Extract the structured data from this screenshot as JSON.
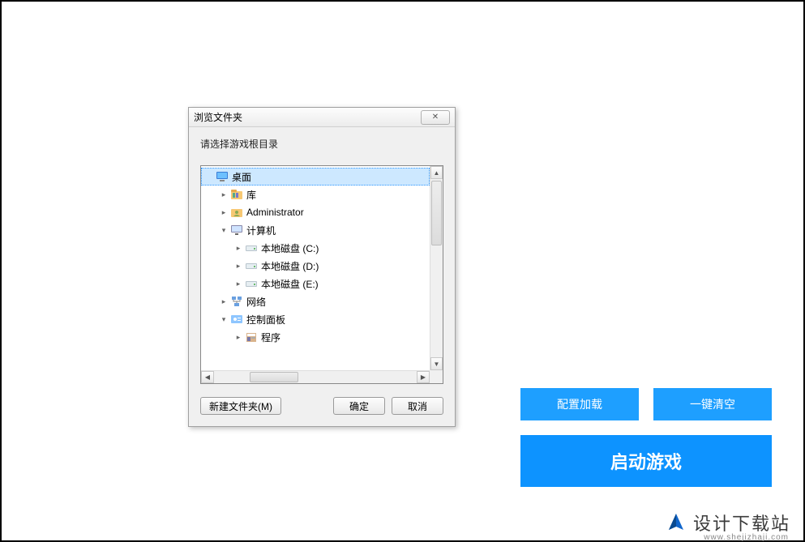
{
  "dialog": {
    "title": "浏览文件夹",
    "close_symbol": "✕",
    "prompt": "请选择游戏根目录",
    "tree": [
      {
        "indent": 0,
        "expander": "none",
        "icon": "desktop-icon",
        "label": "桌面",
        "selected": true
      },
      {
        "indent": 1,
        "expander": "closed",
        "icon": "library-icon",
        "label": "库",
        "selected": false
      },
      {
        "indent": 1,
        "expander": "closed",
        "icon": "user-icon",
        "label": "Administrator",
        "selected": false
      },
      {
        "indent": 1,
        "expander": "open",
        "icon": "computer-icon",
        "label": "计算机",
        "selected": false
      },
      {
        "indent": 2,
        "expander": "closed",
        "icon": "drive-icon",
        "label": "本地磁盘 (C:)",
        "selected": false
      },
      {
        "indent": 2,
        "expander": "closed",
        "icon": "drive-icon",
        "label": "本地磁盘 (D:)",
        "selected": false
      },
      {
        "indent": 2,
        "expander": "closed",
        "icon": "drive-icon",
        "label": "本地磁盘 (E:)",
        "selected": false
      },
      {
        "indent": 1,
        "expander": "closed",
        "icon": "network-icon",
        "label": "网络",
        "selected": false
      },
      {
        "indent": 1,
        "expander": "open",
        "icon": "control-panel-icon",
        "label": "控制面板",
        "selected": false
      },
      {
        "indent": 2,
        "expander": "closed",
        "icon": "programs-icon",
        "label": "程序",
        "selected": false
      }
    ],
    "buttons": {
      "new_folder": "新建文件夹(M)",
      "ok": "确定",
      "cancel": "取消"
    }
  },
  "actions": {
    "config_load": "配置加载",
    "one_click_clear": "一键清空",
    "start_game": "启动游戏"
  },
  "watermark": {
    "cn": "设计下载站",
    "url": "www.shejizhaji.com"
  },
  "colors": {
    "accent": "#1e9fff"
  }
}
